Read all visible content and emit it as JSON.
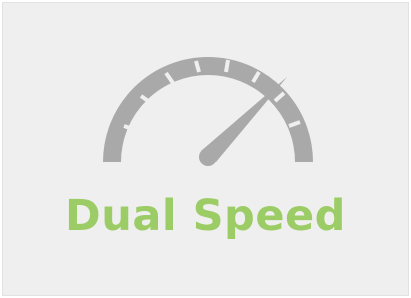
{
  "title": "Dual Speed",
  "icon": "speedometer-icon",
  "colors": {
    "card_background": "#efefef",
    "gauge": "#a9a9a9",
    "title": "#9ccc65"
  }
}
